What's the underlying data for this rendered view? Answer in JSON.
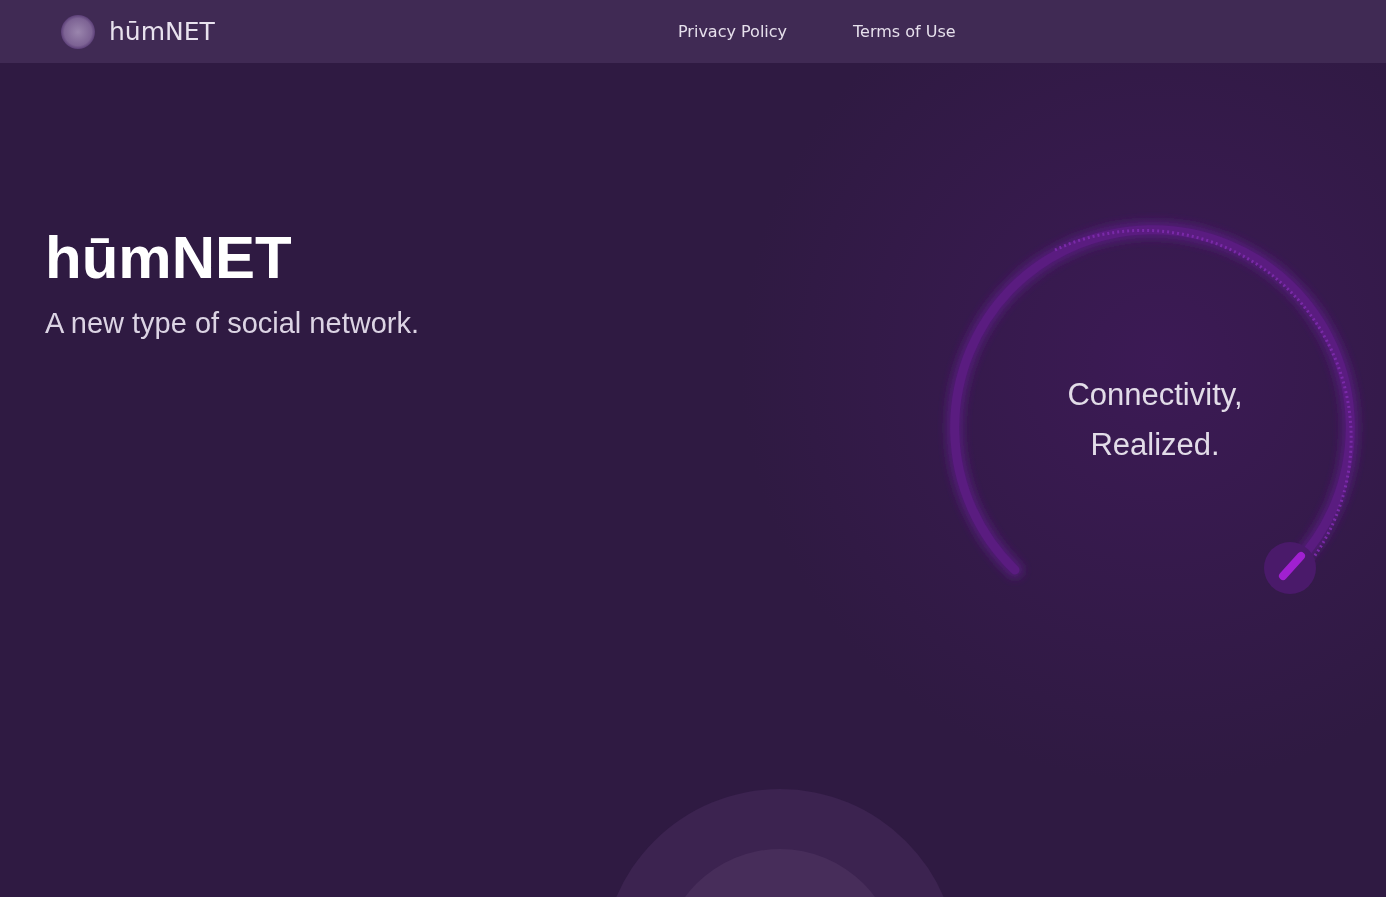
{
  "header": {
    "brand": "hūmNET",
    "links": [
      {
        "label": "Privacy Policy"
      },
      {
        "label": "Terms of Use"
      }
    ]
  },
  "hero": {
    "title": "hūmNET",
    "tagline": "A new type of social network."
  },
  "ring": {
    "lines": [
      "Connectivity,",
      "Realized."
    ]
  }
}
